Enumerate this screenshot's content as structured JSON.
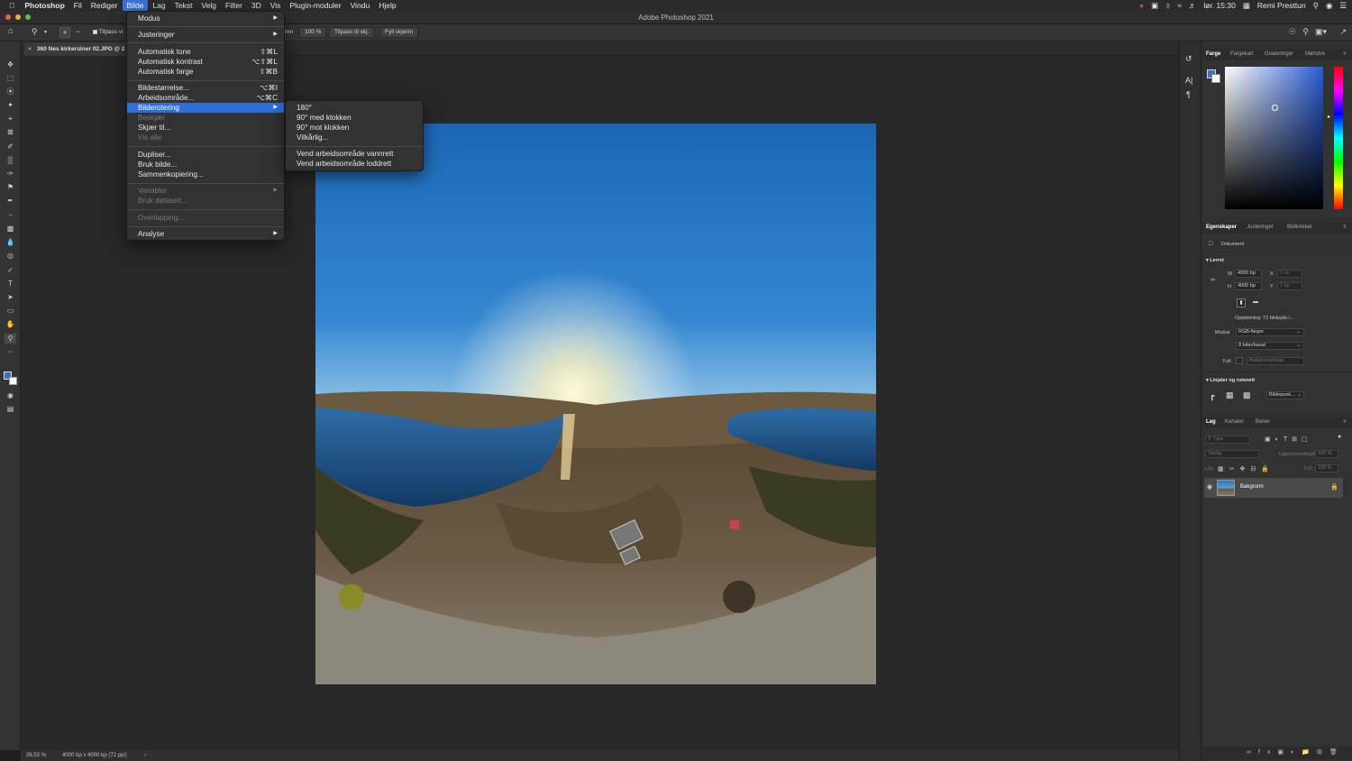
{
  "menubar": {
    "items": [
      "Photoshop",
      "Fil",
      "Rediger",
      "Bilde",
      "Lag",
      "Tekst",
      "Velg",
      "Filter",
      "3D",
      "Vis",
      "Plugin-moduler",
      "Vindu",
      "Hjelp"
    ],
    "clock": "lør. 15:30",
    "user": "Remi Presttun"
  },
  "window": {
    "title": "Adobe Photoshop 2021"
  },
  "options": {
    "fit_windows": "Tilpass vi",
    "ren": "ren",
    "zoom": "100 %",
    "fit_screen": "Tilpass til skj.",
    "fill_screen": "Fyll skjerm"
  },
  "document": {
    "tab": "360 Nes kirkeruiner 02.JPG @ 2"
  },
  "status": {
    "zoom": "26,53 %",
    "info": "4000 bp x 4000 bp (72 ppi)",
    "chevron": "›"
  },
  "bilde_menu": {
    "items": [
      {
        "label": "Modus",
        "shortcut": "",
        "submenu": true
      },
      {
        "label": "Justeringer",
        "shortcut": "",
        "submenu": true
      },
      {
        "label": "Automatisk tone",
        "shortcut": "⇧⌘L"
      },
      {
        "label": "Automatisk kontrast",
        "shortcut": "⌥⇧⌘L"
      },
      {
        "label": "Automatisk farge",
        "shortcut": "⇧⌘B"
      },
      {
        "label": "Bildestørrelse...",
        "shortcut": "⌥⌘I"
      },
      {
        "label": "Arbeidsområde...",
        "shortcut": "⌥⌘C"
      },
      {
        "label": "Bilderotering",
        "shortcut": "",
        "submenu": true
      },
      {
        "label": "Beskjær",
        "shortcut": ""
      },
      {
        "label": "Skjær til...",
        "shortcut": ""
      },
      {
        "label": "Vis alle",
        "shortcut": ""
      },
      {
        "label": "Dupliser...",
        "shortcut": ""
      },
      {
        "label": "Bruk bilde...",
        "shortcut": ""
      },
      {
        "label": "Sammenkopiering...",
        "shortcut": ""
      },
      {
        "label": "Variabler",
        "shortcut": "",
        "submenu": true
      },
      {
        "label": "Bruk datasett...",
        "shortcut": ""
      },
      {
        "label": "Overlapping...",
        "shortcut": ""
      },
      {
        "label": "Analyse",
        "shortcut": "",
        "submenu": true
      }
    ]
  },
  "rotation_menu": {
    "items": [
      "180°",
      "90° med klokken",
      "90° mot klokken",
      "Vilkårlig...",
      "Vend arbeidsområde vannrett",
      "Vend arbeidsområde loddrett"
    ]
  },
  "color_panel": {
    "tabs": [
      "Farge",
      "Fargekart",
      "Graderinger",
      "Mønstre"
    ]
  },
  "properties_panel": {
    "tabs": [
      "Egenskaper",
      "Justeringer",
      "Biblioteker"
    ],
    "doc_label": "Dokument",
    "canvas_section": "Lerret",
    "w_label": "W",
    "w_value": "4000 bp",
    "h_label": "H",
    "h_value": "4000 bp",
    "x_label": "X",
    "y_label": "Y",
    "x_value": "0 bp",
    "y_value": "0 bp",
    "resolution": "Oppløsning: 72 bildepkt./...",
    "mode_label": "Modus",
    "mode_value": "RGB-farger",
    "depth_value": "8 biter/kanal",
    "fill_label": "Fyll",
    "fill_value": "Bakgrunnsfarge",
    "rulers_section": "Linjaler og rutenett",
    "units_value": "Bildepunk..."
  },
  "layers_panel": {
    "tabs": [
      "Lag",
      "Kanaler",
      "Baner"
    ],
    "search_placeholder": "Type",
    "blend": "Vanlig",
    "opacity_label": "Ugjennomsiktighet:",
    "opacity_value": "100 %",
    "lock_label": "Lås:",
    "fill_label": "Fyll:",
    "fill_value": "100 %",
    "layer_name": "Bakgrunn"
  },
  "colors": {
    "accent": "#2f6fd9",
    "menubar_active": "#3a74d8",
    "foreground_swatch": "#3f6fc9"
  }
}
